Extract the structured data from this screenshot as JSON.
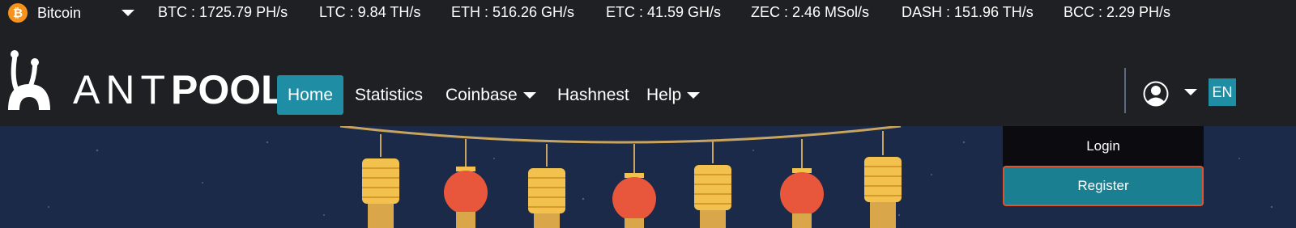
{
  "ticker": {
    "coin": "Bitcoin",
    "coin_icon": "bitcoin-icon",
    "rates": [
      "BTC : 1725.79 PH/s",
      "LTC : 9.84 TH/s",
      "ETH : 516.26 GH/s",
      "ETC : 41.59 GH/s",
      "ZEC : 2.46 MSol/s",
      "DASH : 151.96 TH/s",
      "BCC : 2.29 PH/s"
    ]
  },
  "logo": {
    "ant": "ANT",
    "pool": "POOL"
  },
  "nav": {
    "home": "Home",
    "statistics": "Statistics",
    "coinbase": "Coinbase",
    "hashnest": "Hashnest",
    "help": "Help"
  },
  "user_menu": {
    "lang": "EN",
    "login": "Login",
    "register": "Register"
  },
  "colors": {
    "accent": "#1f8ea4",
    "header_bg": "#1f2023",
    "banner_bg": "#1a2a48",
    "register_border": "#e2522b",
    "bitcoin": "#f7931a",
    "lantern_gold": "#f2c14e",
    "lantern_red": "#e8563c"
  }
}
